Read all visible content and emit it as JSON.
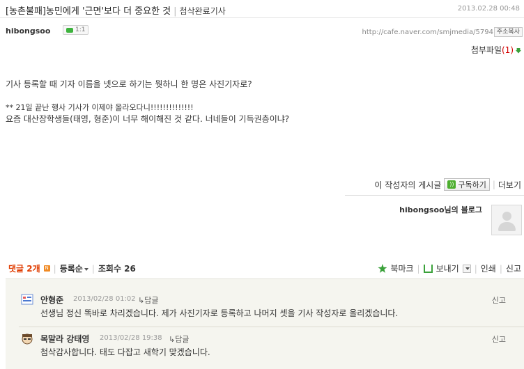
{
  "post": {
    "title": "[농촌불패]농민에게 '근면'보다 더 중요한 것",
    "category": "첨삭완료기사",
    "date": "2013.02.28 00:48",
    "author": "hibongsoo",
    "chat_label": "1:1",
    "url": "http://cafe.naver.com/smjmedia/5794",
    "copy_label": "주소복사",
    "attachment_label": "첨부파일",
    "attachment_count": "(1)",
    "body_lines": [
      "기사 등록할 때 기자 이름을 넷으로 하기는 뭣하니 한 명은 사진기자로?",
      "** 21일 끝난 행사 기사가 이제야 올라오다니!!!!!!!!!!!!!!",
      "요즘 대산장학생들(태영, 형준)이 너무 해이해진 것 같다. 너네들이 기득권층이냐?"
    ]
  },
  "subscribe": {
    "prefix": "이 작성자의 게시글",
    "button": "구독하기",
    "more": "더보기"
  },
  "blog": {
    "name": "hibongsoo님의 블로그"
  },
  "comment_bar": {
    "count_label": "댓글 2개",
    "new_badge": "N",
    "sort_label": "등록순",
    "views_label": "조회수 26",
    "bookmark": "북마크",
    "send": "보내기",
    "print": "인쇄",
    "report": "신고"
  },
  "comments": [
    {
      "name": "안형준",
      "date": "2013/02/28 01:02",
      "reply": "답글",
      "report": "신고",
      "text": "선생님 정신 똑바로 차리겠습니다. 제가 사진기자로 등록하고 나머지 셋을 기사 작성자로 올리겠습니다."
    },
    {
      "name": "목말라 강태영",
      "date": "2013/02/28 19:38",
      "reply": "답글",
      "report": "신고",
      "text": "첨삭감사합니다. 태도 다잡고 새학기 맞겠습니다."
    }
  ],
  "colors": {
    "accent_green": "#3aa13a",
    "comment_count": "#e03c00",
    "comment_bg": "#f5f5ef"
  }
}
